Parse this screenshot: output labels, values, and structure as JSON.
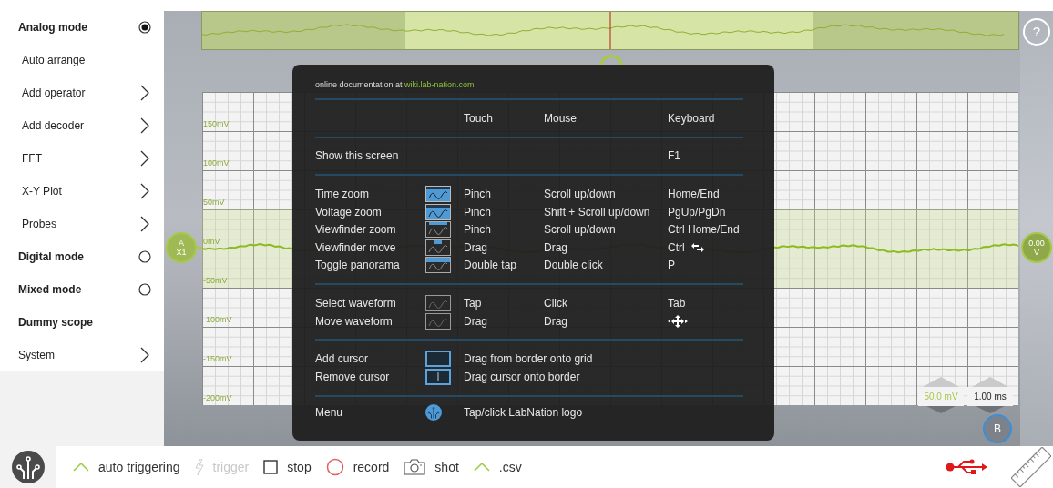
{
  "sidebar": {
    "items": [
      {
        "label": "Analog mode",
        "kind": "mode",
        "selected": true
      },
      {
        "label": "Auto arrange",
        "kind": "action"
      },
      {
        "label": "Add operator",
        "kind": "submenu"
      },
      {
        "label": "Add decoder",
        "kind": "submenu"
      },
      {
        "label": "FFT",
        "kind": "submenu"
      },
      {
        "label": "X-Y Plot",
        "kind": "submenu"
      },
      {
        "label": "Probes",
        "kind": "submenu"
      },
      {
        "label": "Digital mode",
        "kind": "mode",
        "selected": false
      },
      {
        "label": "Mixed mode",
        "kind": "mode",
        "selected": false
      },
      {
        "label": "Dummy scope",
        "kind": "heading"
      },
      {
        "label": "System",
        "kind": "category"
      }
    ]
  },
  "scope": {
    "y_axis_labels": [
      "150mV",
      "100mV",
      "50mV",
      "0mV",
      "-50mV",
      "-100mV",
      "-150mV",
      "-200mV"
    ],
    "channel_marker": {
      "name": "A",
      "probe": "X1"
    },
    "offset_marker": {
      "value": "0.00",
      "unit": "V"
    },
    "voltage_scale": "50.0 mV",
    "time_scale": "1.00 ms",
    "marker_b": "B",
    "help_button": "?"
  },
  "help_overlay": {
    "doc_text": "online documentation at ",
    "doc_link": "wiki.lab-nation.com",
    "columns": [
      "Touch",
      "Mouse",
      "Keyboard"
    ],
    "sections": [
      [
        {
          "action": "Show this screen",
          "keyboard": "F1"
        }
      ],
      [
        {
          "action": "Time zoom",
          "kind": "time-zoom",
          "touch": "Pinch",
          "mouse": "Scroll up/down",
          "keyboard": "Home/End"
        },
        {
          "action": "Voltage zoom",
          "kind": "voltage-zoom",
          "touch": "Pinch",
          "mouse": "Shift + Scroll up/down",
          "keyboard": "PgUp/PgDn"
        },
        {
          "action": "Viewfinder zoom",
          "kind": "viewfinder-zoom",
          "touch": "Pinch",
          "mouse": "Scroll up/down",
          "keyboard": "Ctrl Home/End"
        },
        {
          "action": "Viewfinder move",
          "kind": "viewfinder-move",
          "touch": "Drag",
          "mouse": "Drag",
          "keyboard": "Ctrl"
        },
        {
          "action": "Toggle panorama",
          "kind": "panorama",
          "touch": "Double tap",
          "mouse": "Double click",
          "keyboard": "P"
        }
      ],
      [
        {
          "action": "Select waveform",
          "kind": "select-waveform",
          "touch": "Tap",
          "mouse": "Click",
          "keyboard": "Tab"
        },
        {
          "action": "Move waveform",
          "kind": "move-waveform",
          "touch": "Drag",
          "mouse": "Drag"
        }
      ],
      [
        {
          "action": "Add cursor",
          "kind": "add-cursor",
          "hint": "Drag from border onto grid"
        },
        {
          "action": "Remove cursor",
          "kind": "remove-cursor",
          "hint": "Drag cursor onto border"
        }
      ],
      [
        {
          "action": "Menu",
          "kind": "menu",
          "hint": "Tap/click LabNation logo"
        }
      ]
    ]
  },
  "toolbar": {
    "items": [
      {
        "kind": "chevron",
        "label": "auto triggering",
        "disabled": false
      },
      {
        "kind": "bolt",
        "label": "trigger",
        "disabled": true
      },
      {
        "kind": "checkbox",
        "label": "stop",
        "checked": false,
        "disabled": false
      },
      {
        "kind": "record",
        "label": "record",
        "disabled": false
      },
      {
        "kind": "camera",
        "label": "shot",
        "disabled": false
      },
      {
        "kind": "chevron",
        "label": ".csv",
        "disabled": false
      }
    ]
  }
}
